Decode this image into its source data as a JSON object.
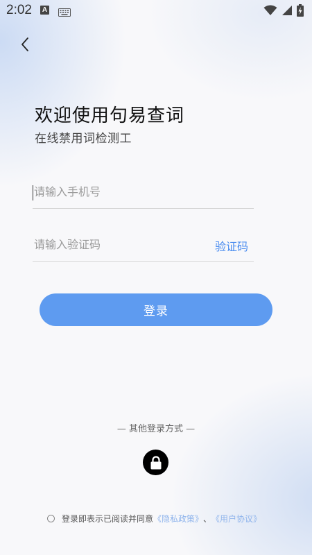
{
  "status_bar": {
    "time": "2:02",
    "notification_letter": "A"
  },
  "header": {
    "title": "欢迎使用句易查词",
    "subtitle": "在线禁用词检测工"
  },
  "form": {
    "phone_placeholder": "请输入手机号",
    "code_placeholder": "请输入验证码",
    "code_button": "验证码",
    "login_button": "登录"
  },
  "other_login": {
    "label": "— 其他登录方式 —"
  },
  "agreement": {
    "text": "登录即表示已阅读并同意",
    "privacy_link": "《隐私政策》",
    "separator": "、",
    "terms_link": "《用户协议》"
  },
  "colors": {
    "accent": "#5e9bf0",
    "link": "#4b8df0"
  }
}
